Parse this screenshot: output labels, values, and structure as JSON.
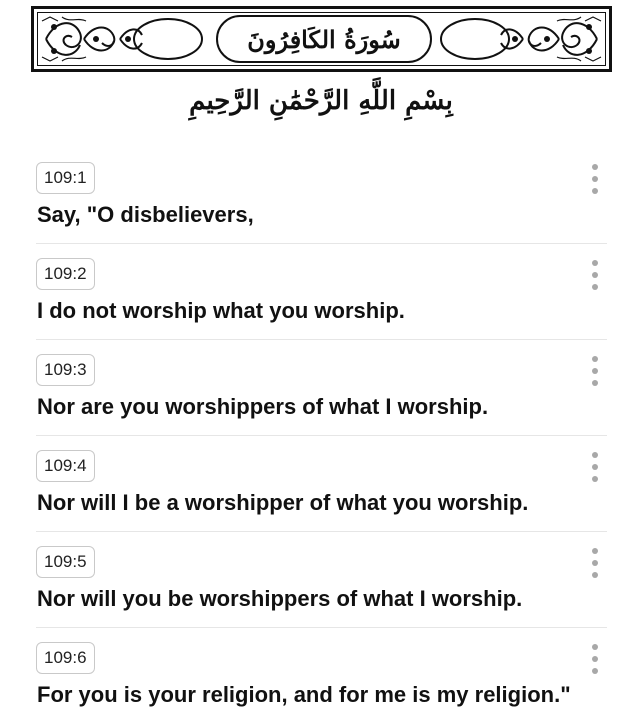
{
  "surah": {
    "title": "سُورَةُ الكَافِرُونَ",
    "basmala": "بِسْمِ اللَّهِ الرَّحْمَٰنِ الرَّحِيمِ"
  },
  "ayahs": [
    {
      "ref": "109:1",
      "text": "Say, \"O disbelievers,"
    },
    {
      "ref": "109:2",
      "text": "I do not worship what you worship."
    },
    {
      "ref": "109:3",
      "text": "Nor are you worshippers of what I worship."
    },
    {
      "ref": "109:4",
      "text": "Nor will I be a worshipper of what you worship."
    },
    {
      "ref": "109:5",
      "text": "Nor will you be worshippers of what I worship."
    },
    {
      "ref": "109:6",
      "text": "For you is your religion, and for me is my religion.\""
    }
  ],
  "icons": {
    "more": "more-vertical-icon"
  }
}
